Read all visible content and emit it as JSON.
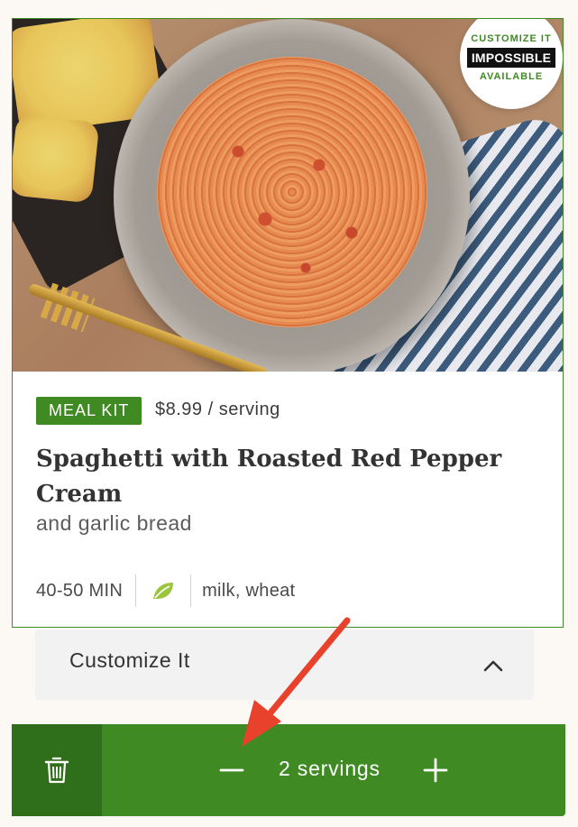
{
  "badge": {
    "top_text": "Customize It",
    "brand": "IMPOSSIBLE",
    "bottom_text": "Available"
  },
  "meal": {
    "tag": "MEAL KIT",
    "price": "$8.99 / serving",
    "title": "Spaghetti with Roasted Red Pepper Cream",
    "subtitle": "and garlic bread",
    "time": "40-50 MIN",
    "diet_icon": "leaf-icon",
    "allergens": "milk, wheat"
  },
  "customize": {
    "label": "Customize It",
    "expanded": true
  },
  "servings": {
    "count_label": "2 servings",
    "count": 2
  },
  "colors": {
    "brand_green": "#3f8a23",
    "dark_green": "#2f6e1a",
    "annotation_arrow": "#e8412c"
  }
}
